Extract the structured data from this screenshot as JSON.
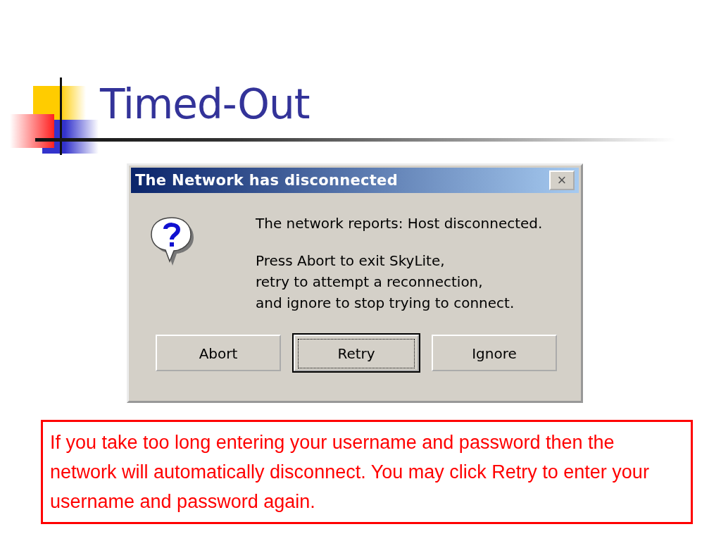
{
  "slide": {
    "title": "Timed-Out"
  },
  "dialog": {
    "title": "The Network has disconnected",
    "close": "×",
    "message": "The network reports: Host disconnected.",
    "instructions": [
      "Press Abort to exit SkyLite,",
      "retry to attempt a reconnection,",
      "and ignore to stop trying to connect."
    ],
    "buttons": [
      {
        "label": "Abort",
        "selected": false
      },
      {
        "label": "Retry",
        "selected": true
      },
      {
        "label": "Ignore",
        "selected": false
      }
    ]
  },
  "note": "If you take too long entering your username and password then the network will automatically disconnect.  You may click Retry to enter your username and password again."
}
